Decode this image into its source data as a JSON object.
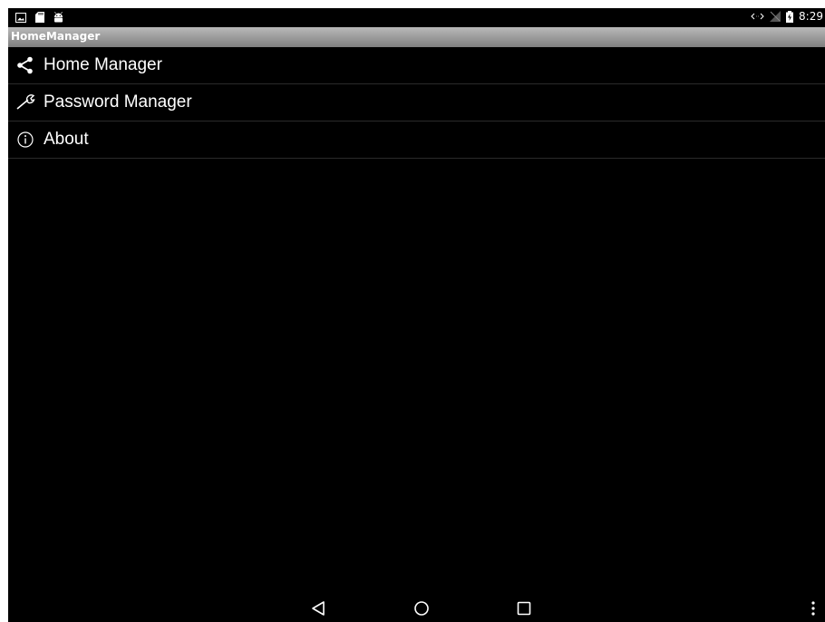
{
  "status_bar": {
    "left_icons": [
      "image-icon",
      "sd-card-icon",
      "android-icon"
    ],
    "right_icons": [
      "data-transfer-icon",
      "no-signal-icon",
      "battery-charging-icon"
    ],
    "time": "8:29"
  },
  "app": {
    "title": "HomeManager"
  },
  "menu": {
    "items": [
      {
        "label": "Home Manager",
        "icon": "share-icon"
      },
      {
        "label": "Password Manager",
        "icon": "wrench-icon"
      },
      {
        "label": "About",
        "icon": "info-icon"
      }
    ]
  },
  "nav": {
    "buttons": [
      "back-icon",
      "home-icon",
      "recents-icon",
      "overflow-menu-icon"
    ]
  },
  "colors": {
    "background": "#000000",
    "title_bar_top": "#b9b9b9",
    "title_bar_bottom": "#7f7f7f",
    "text": "#ffffff",
    "divider": "#2a2a2a"
  }
}
